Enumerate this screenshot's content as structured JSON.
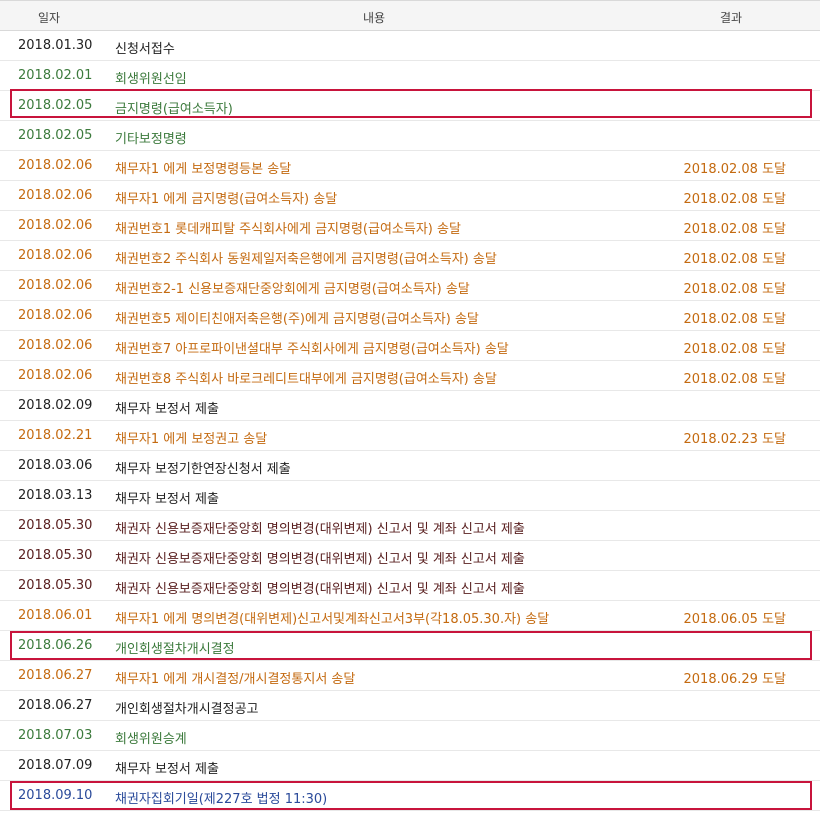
{
  "headers": {
    "date": "일자",
    "content": "내용",
    "result": "결과"
  },
  "rows": [
    {
      "date": "2018.01.30",
      "content": "신청서접수",
      "result": "",
      "color": "#222222"
    },
    {
      "date": "2018.02.01",
      "content": "회생위원선임",
      "result": "",
      "color": "#3c7a3c"
    },
    {
      "date": "2018.02.05",
      "content": "금지명령(급여소득자)",
      "result": "",
      "color": "#3c7a3c"
    },
    {
      "date": "2018.02.05",
      "content": "기타보정명령",
      "result": "",
      "color": "#3c7a3c"
    },
    {
      "date": "2018.02.06",
      "content": "채무자1          에게 보정명령등본 송달",
      "result": "2018.02.08 도달",
      "color": "#c46a10"
    },
    {
      "date": "2018.02.06",
      "content": "채무자1          에게 금지명령(급여소득자) 송달",
      "result": "2018.02.08 도달",
      "color": "#c46a10"
    },
    {
      "date": "2018.02.06",
      "content": "채권번호1 롯데캐피탈 주식회사에게 금지명령(급여소득자) 송달",
      "result": "2018.02.08 도달",
      "color": "#c46a10"
    },
    {
      "date": "2018.02.06",
      "content": "채권번호2 주식회사 동원제일저축은행에게 금지명령(급여소득자) 송달",
      "result": "2018.02.08 도달",
      "color": "#c46a10"
    },
    {
      "date": "2018.02.06",
      "content": "채권번호2-1 신용보증재단중앙회에게 금지명령(급여소득자) 송달",
      "result": "2018.02.08 도달",
      "color": "#c46a10"
    },
    {
      "date": "2018.02.06",
      "content": "채권번호5 제이티친애저축은행(주)에게 금지명령(급여소득자) 송달",
      "result": "2018.02.08 도달",
      "color": "#c46a10"
    },
    {
      "date": "2018.02.06",
      "content": "채권번호7 아프로파이낸셜대부 주식회사에게 금지명령(급여소득자) 송달",
      "result": "2018.02.08 도달",
      "color": "#c46a10"
    },
    {
      "date": "2018.02.06",
      "content": "채권번호8 주식회사 바로크레디트대부에게 금지명령(급여소득자) 송달",
      "result": "2018.02.08 도달",
      "color": "#c46a10"
    },
    {
      "date": "2018.02.09",
      "content": "채무자          보정서 제출",
      "result": "",
      "color": "#222222"
    },
    {
      "date": "2018.02.21",
      "content": "채무자1          에게 보정권고 송달",
      "result": "2018.02.23 도달",
      "color": "#c46a10"
    },
    {
      "date": "2018.03.06",
      "content": "채무자          보정기한연장신청서 제출",
      "result": "",
      "color": "#222222"
    },
    {
      "date": "2018.03.13",
      "content": "채무자          보정서 제출",
      "result": "",
      "color": "#222222"
    },
    {
      "date": "2018.05.30",
      "content": "채권자 신용보증재단중앙회 명의변경(대위변제) 신고서 및 계좌 신고서 제출",
      "result": "",
      "color": "#5a2020"
    },
    {
      "date": "2018.05.30",
      "content": "채권자 신용보증재단중앙회 명의변경(대위변제) 신고서 및 계좌 신고서 제출",
      "result": "",
      "color": "#5a2020"
    },
    {
      "date": "2018.05.30",
      "content": "채권자 신용보증재단중앙회 명의변경(대위변제) 신고서 및 계좌 신고서 제출",
      "result": "",
      "color": "#5a2020"
    },
    {
      "date": "2018.06.01",
      "content": "채무자1          에게 명의변경(대위변제)신고서및계좌신고서3부(각18.05.30.자) 송달",
      "result": "2018.06.05 도달",
      "color": "#c46a10"
    },
    {
      "date": "2018.06.26",
      "content": "개인회생절차개시결정",
      "result": "",
      "color": "#3c7a3c"
    },
    {
      "date": "2018.06.27",
      "content": "채무자1          에게 개시결정/개시결정통지서 송달",
      "result": "2018.06.29 도달",
      "color": "#c46a10"
    },
    {
      "date": "2018.06.27",
      "content": "개인회생절차개시결정공고",
      "result": "",
      "color": "#222222"
    },
    {
      "date": "2018.07.03",
      "content": "회생위원승계",
      "result": "",
      "color": "#3c7a3c"
    },
    {
      "date": "2018.07.09",
      "content": "채무자          보정서 제출",
      "result": "",
      "color": "#222222"
    },
    {
      "date": "2018.09.10",
      "content": "채권자집회기일(제227호 법정 11:30)",
      "result": "",
      "color": "#2a4a9a"
    }
  ],
  "highlighted_rows": [
    "2018.02.05 금지명령(급여소득자)",
    "2018.06.26 개인회생절차개시결정",
    "2018.09.10 채권자집회기일(제227호 법정 11:30)"
  ]
}
